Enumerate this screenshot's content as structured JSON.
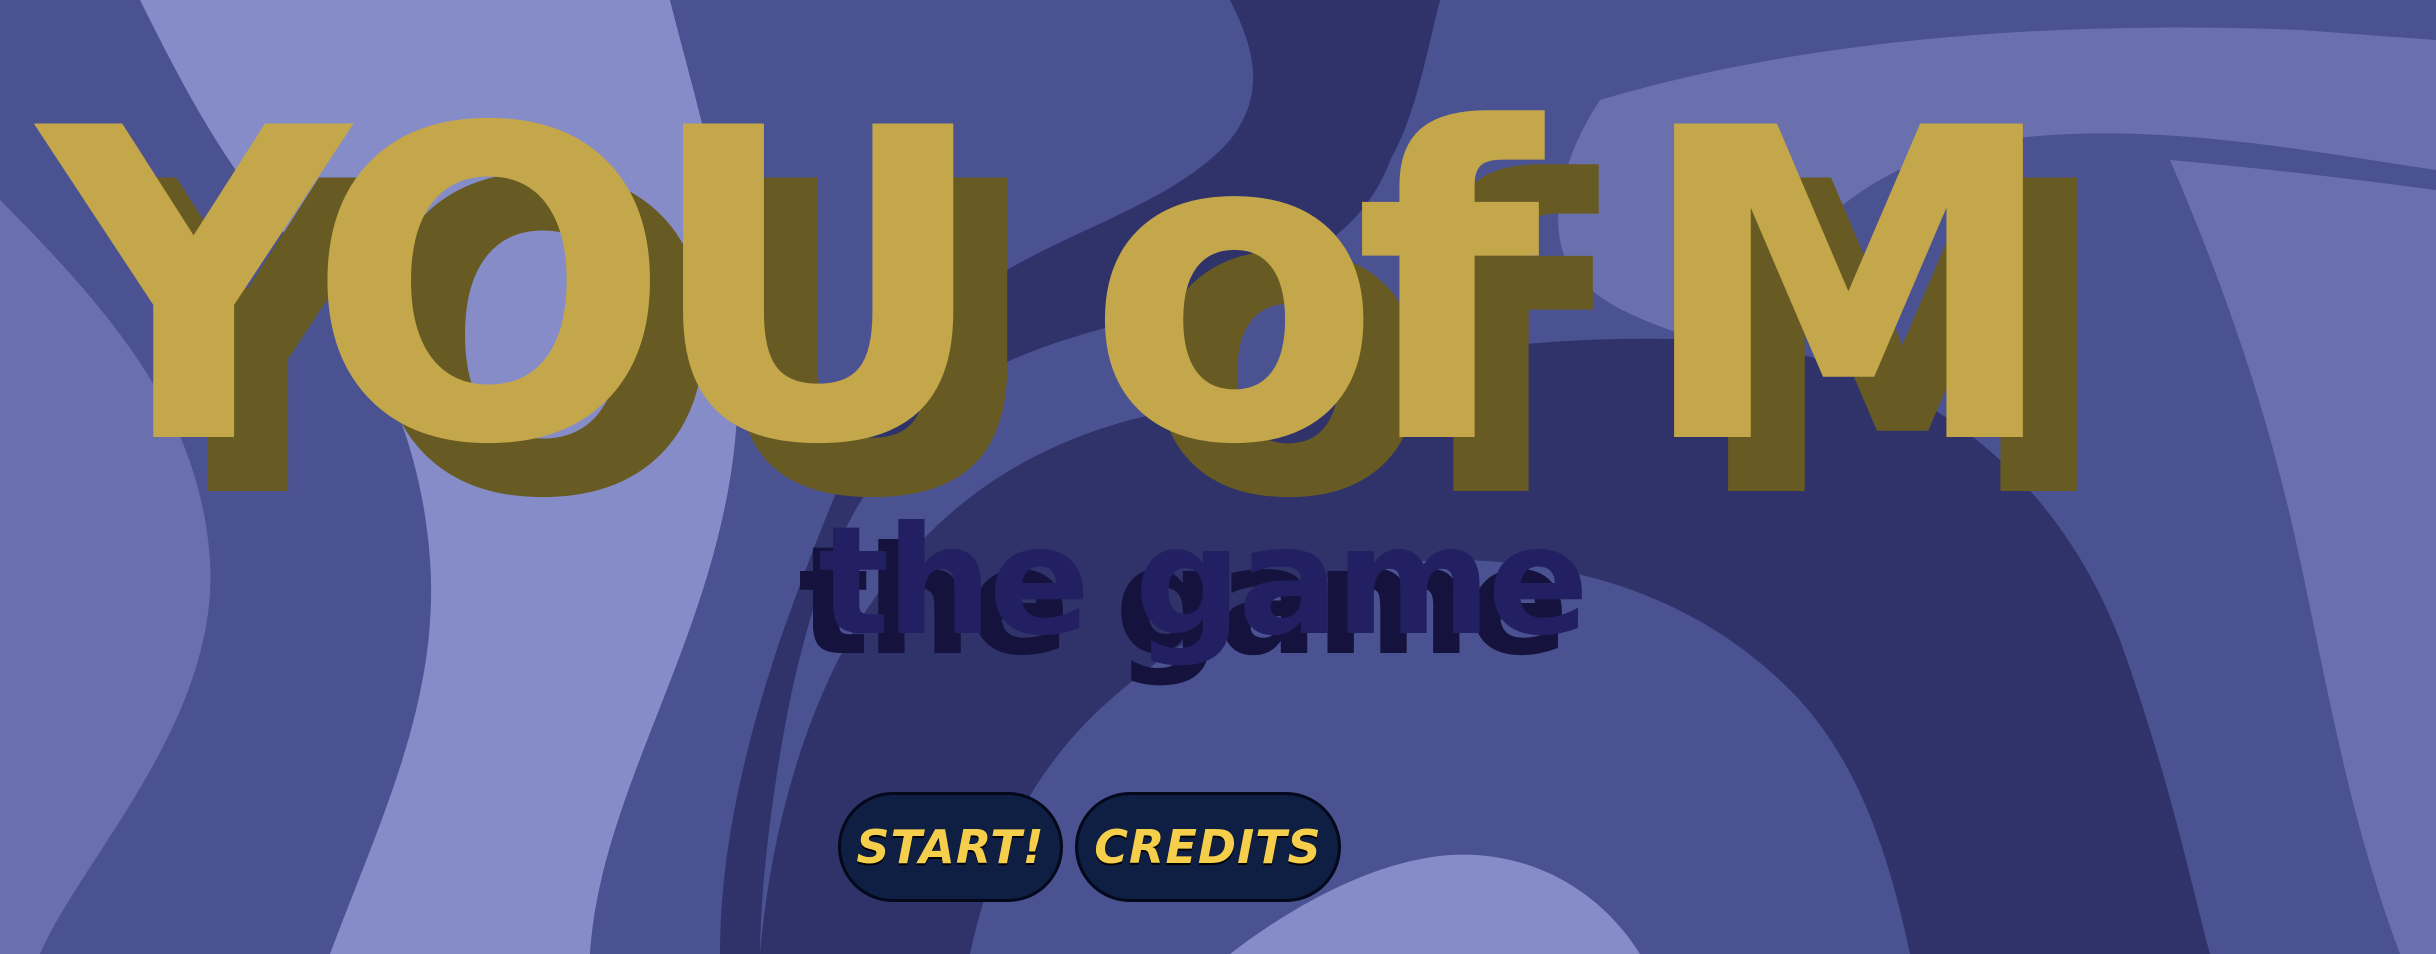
{
  "title": {
    "line1": "YOU of M",
    "line2": "the game"
  },
  "buttons": {
    "start_label": "START!",
    "credits_label": "CREDITS"
  },
  "colors": {
    "background": "#4a5292",
    "title_gold": "#c3a74a",
    "title_shadow": "#675a23",
    "subtitle": "#231f63",
    "button_bg": "#0f1f43",
    "button_text": "#f5cf4c"
  }
}
